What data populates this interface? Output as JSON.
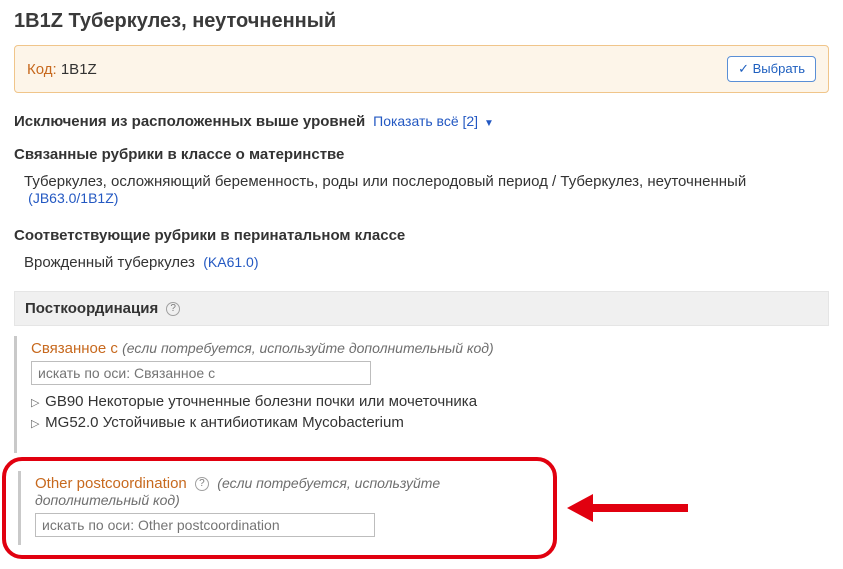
{
  "header": {
    "title": "1B1Z Туберкулез, неуточненный"
  },
  "code_bar": {
    "label": "Код:",
    "value": "1B1Z",
    "select_btn": "✓ Выбрать"
  },
  "exclusions": {
    "heading": "Исключения из расположенных выше уровней",
    "show_all_text": "Показать всё [2]"
  },
  "maternal": {
    "heading": "Связанные рубрики в классе о материнстве",
    "text": "Туберкулез, осложняющий беременность, роды или послеродовый период / Туберкулез, неуточненный",
    "code_link": "(JB63.0/1B1Z)"
  },
  "perinatal": {
    "heading": "Соответствующие рубрики в перинатальном классе",
    "text": "Врожденный туберкулез",
    "code_link": "(KA61.0)"
  },
  "postcoord": {
    "heading": "Посткоординация",
    "help": "?",
    "axis1": {
      "name": "Связанное с",
      "hint": "(если потребуется, используйте дополнительный код)",
      "placeholder": "искать по оси: Связанное с",
      "items": [
        "GB90 Некоторые уточненные болезни почки или мочеточника",
        "MG52.0 Устойчивые к антибиотикам Mycobacterium"
      ]
    },
    "axis2": {
      "name": "Other postcoordination",
      "hint": "(если потребуется, используйте дополнительный код)",
      "placeholder": "искать по оси: Other postcoordination",
      "help": "?"
    }
  }
}
